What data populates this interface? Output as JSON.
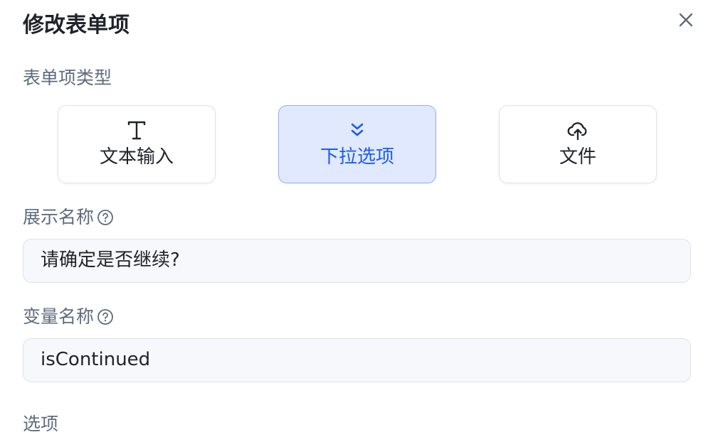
{
  "dialog": {
    "title": "修改表单项"
  },
  "form_type": {
    "label": "表单项类型",
    "options": [
      {
        "label": "文本输入",
        "icon": "text-icon",
        "selected": false
      },
      {
        "label": "下拉选项",
        "icon": "chevron-double-down-icon",
        "selected": true
      },
      {
        "label": "文件",
        "icon": "cloud-upload-icon",
        "selected": false
      }
    ]
  },
  "display_name": {
    "label": "展示名称",
    "value": "请确定是否继续?"
  },
  "variable_name": {
    "label": "变量名称",
    "value": "isContinued"
  },
  "options_section": {
    "label": "选项"
  },
  "colors": {
    "accent": "#1a5cf0",
    "selected_bg": "#e1e9ff",
    "label_gray": "#5f6b7e"
  }
}
